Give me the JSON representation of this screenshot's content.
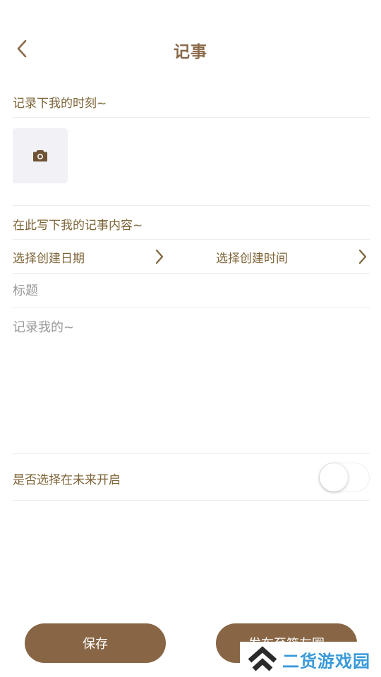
{
  "header": {
    "title": "记事",
    "back_icon": "chevron-left-icon"
  },
  "form": {
    "moment_label": "记录下我的时刻~",
    "photo_icon": "camera-icon",
    "content_label": "在此写下我的记事内容~",
    "date_picker_label": "选择创建日期",
    "time_picker_label": "选择创建时间",
    "title_placeholder": "标题",
    "title_value": "",
    "content_placeholder": "记录我的~",
    "content_value": "",
    "future_label": "是否选择在未来开启",
    "future_enabled": false
  },
  "actions": {
    "save_label": "保存",
    "publish_label": "发布至箱友圈"
  },
  "watermark": {
    "text": "二货游戏园"
  },
  "colors": {
    "accent": "#886645",
    "label_text": "#7d6437",
    "title_text": "#8a6a4a",
    "placeholder": "#9a9a9a",
    "photo_bg": "#f1f1f6",
    "watermark_text": "#3a9ad9"
  }
}
